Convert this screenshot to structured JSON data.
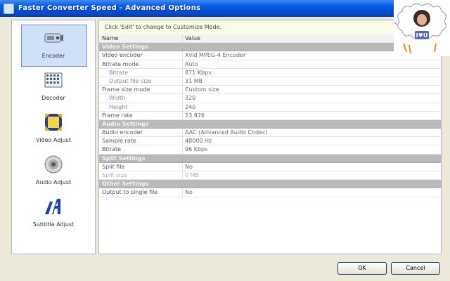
{
  "window": {
    "title": "Faster Converter Speed - Advanced Options"
  },
  "sidebar": {
    "items": [
      {
        "label": "Encoder",
        "icon": "encoder-icon",
        "active": true
      },
      {
        "label": "Decoder",
        "icon": "decoder-icon",
        "active": false
      },
      {
        "label": "Video Adjust",
        "icon": "video-adjust-icon",
        "active": false
      },
      {
        "label": "Audio Adjust",
        "icon": "audio-adjust-icon",
        "active": false
      },
      {
        "label": "Subtitle Adjust",
        "icon": "subtitle-adjust-icon",
        "active": false
      }
    ]
  },
  "main": {
    "hint": "Click 'Edit' to change to Customize Mode.",
    "columns": {
      "name": "Name",
      "value": "Value"
    },
    "rows": [
      {
        "type": "section",
        "name": "Video Settings"
      },
      {
        "type": "item",
        "name": "Video encoder",
        "value": "Xvid MPEG-4 Encoder"
      },
      {
        "type": "item",
        "name": "Bitrate mode",
        "value": "Auto"
      },
      {
        "type": "sub",
        "name": "Bitrate",
        "value": "871 Kbps"
      },
      {
        "type": "sub",
        "name": "Output file size",
        "value": "31 MB"
      },
      {
        "type": "item",
        "name": "Frame size mode",
        "value": "Custom size"
      },
      {
        "type": "sub",
        "name": "Width",
        "value": "320"
      },
      {
        "type": "sub",
        "name": "Height",
        "value": "240"
      },
      {
        "type": "item",
        "name": "Frame rate",
        "value": "23.976"
      },
      {
        "type": "section",
        "name": "Audio Settings"
      },
      {
        "type": "item",
        "name": "Audio encoder",
        "value": "AAC (Advanced Audio Codec)"
      },
      {
        "type": "item",
        "name": "Sample rate",
        "value": "48000 Hz"
      },
      {
        "type": "item",
        "name": "Bitrate",
        "value": "96 Kbps"
      },
      {
        "type": "section",
        "name": "Split Settings"
      },
      {
        "type": "item",
        "name": "Split file",
        "value": "No"
      },
      {
        "type": "disabled",
        "name": "Split size",
        "value": "0 MB"
      },
      {
        "type": "section",
        "name": "Other Settings"
      },
      {
        "type": "item",
        "name": "Output to single file",
        "value": "No"
      }
    ]
  },
  "buttons": {
    "ok": "OK",
    "cancel": "Cancel"
  },
  "colors": {
    "titlebar": "#0050d8",
    "selection": "#cfe0f8",
    "section": "#b9b9b9",
    "window_bg": "#ece9d8"
  }
}
